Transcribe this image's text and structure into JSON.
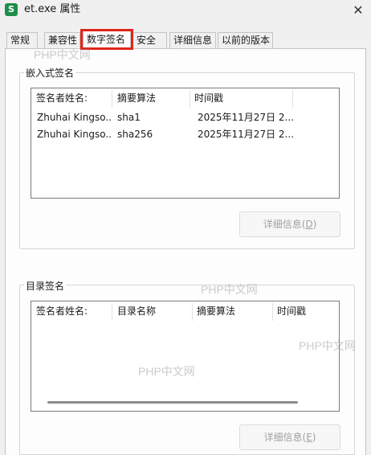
{
  "window": {
    "icon_letter": "S",
    "title": "et.exe 属性",
    "close_glyph": "✕"
  },
  "tabs": [
    {
      "label": "常规"
    },
    {
      "label": "兼容性"
    },
    {
      "label": "数字签名",
      "active": true
    },
    {
      "label": "安全"
    },
    {
      "label": "详细信息"
    },
    {
      "label": "以前的版本"
    }
  ],
  "embedded": {
    "group_label": "嵌入式签名",
    "columns": [
      "签名者姓名:",
      "摘要算法",
      "时间戳"
    ],
    "rows": [
      [
        "Zhuhai Kingso...",
        "sha1",
        "2025年11月27日 2..."
      ],
      [
        "Zhuhai Kingso...",
        "sha256",
        "2025年11月27日 2..."
      ]
    ],
    "details_button": {
      "text": "详细信息(",
      "mnemonic": "D",
      "suffix": ")"
    }
  },
  "catalog": {
    "group_label": "目录签名",
    "columns": [
      "签名者姓名:",
      "目录名称",
      "摘要算法",
      "时间戳"
    ],
    "details_button": {
      "text": "详细信息(",
      "mnemonic": "E",
      "suffix": ")"
    }
  },
  "watermark": "PHP中文网",
  "colors": {
    "highlight": "#e0261b",
    "app_icon": "#1e8f4b"
  }
}
